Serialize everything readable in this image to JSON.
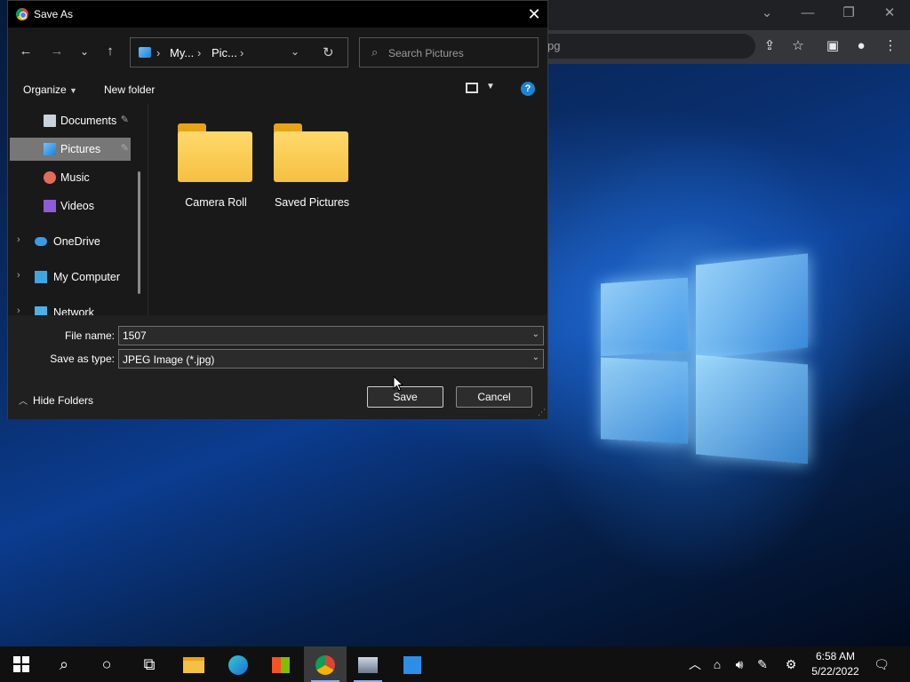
{
  "browser": {
    "omnibox_fragment": "pg",
    "window_controls": [
      "chevron-down-icon",
      "minimize-icon",
      "restore-icon",
      "close-icon"
    ],
    "toolbar_icons": [
      "share-icon",
      "star-icon",
      "sidepanel-icon",
      "profile-icon",
      "menu-icon"
    ]
  },
  "dialog": {
    "title": "Save As",
    "breadcrumb": [
      "My...",
      "Pic..."
    ],
    "search_placeholder": "Search Pictures",
    "toolbar": {
      "organize": "Organize",
      "new_folder": "New folder"
    },
    "nav_items": [
      {
        "label": "Documents",
        "icon": "document-icon",
        "pinned": true
      },
      {
        "label": "Pictures",
        "icon": "pictures-icon",
        "pinned": true,
        "selected": true
      },
      {
        "label": "Music",
        "icon": "music-icon",
        "pinned": false
      },
      {
        "label": "Videos",
        "icon": "videos-icon",
        "pinned": false
      },
      {
        "label": "OneDrive",
        "icon": "cloud-icon",
        "expandable": true
      },
      {
        "label": "My Computer",
        "icon": "computer-icon",
        "expandable": true
      },
      {
        "label": "Network",
        "icon": "network-icon",
        "expandable": true
      }
    ],
    "folders": [
      {
        "name": "Camera Roll"
      },
      {
        "name": "Saved Pictures"
      }
    ],
    "file_name_label": "File name:",
    "file_name_value": "1507",
    "save_type_label": "Save as type:",
    "save_type_value": "JPEG Image (*.jpg)",
    "hide_folders": "Hide Folders",
    "save_button": "Save",
    "cancel_button": "Cancel"
  },
  "taskbar": {
    "apps": [
      "start-icon",
      "search-icon",
      "cortana-icon",
      "task-view-icon",
      "file-explorer-icon",
      "edge-icon",
      "store-icon",
      "chrome-icon",
      "app-icon",
      "app-icon-2"
    ],
    "time": "6:58 AM",
    "date": "5/22/2022"
  },
  "colors": {
    "accent": "#1f83d6",
    "dialog_bg": "#191919",
    "taskbar_bg": "#101010"
  }
}
